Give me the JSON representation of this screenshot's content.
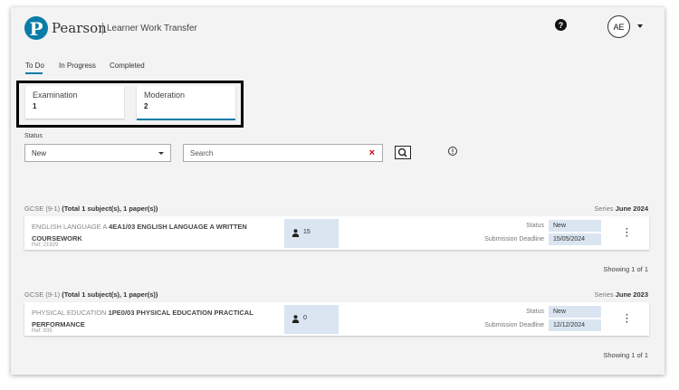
{
  "header": {
    "logo_letter": "P",
    "brand": "Pearson",
    "app_title": "Learner Work Transfer",
    "help_symbol": "?",
    "avatar_initials": "AE"
  },
  "tabs": [
    {
      "label": "To Do",
      "active": true
    },
    {
      "label": "In Progress",
      "active": false
    },
    {
      "label": "Completed",
      "active": false
    }
  ],
  "type_cards": [
    {
      "label": "Examination",
      "count": "1",
      "active": false
    },
    {
      "label": "Moderation",
      "count": "2",
      "active": true
    }
  ],
  "filters": {
    "status_label": "Status",
    "status_value": "New",
    "search_placeholder": "Search",
    "clear_symbol": "×"
  },
  "groups": [
    {
      "qualification": "GCSE (9-1)",
      "summary": "(Total 1 subject(s), 1 paper(s))",
      "series_label": "Series",
      "series_value": "June 2024",
      "row": {
        "subject": "ENGLISH LANGUAGE A",
        "paper": "4EA1/03 ENGLISH LANGUAGE A WRITTEN COURSEWORK",
        "ref": "Ref: 21929",
        "learners": "15",
        "status_label": "Status",
        "status_value": "New",
        "deadline_label": "Submission Deadline",
        "deadline_value": "15/05/2024"
      },
      "showing": "Showing 1 of 1"
    },
    {
      "qualification": "GCSE (9-1)",
      "summary": "(Total 1 subject(s), 1 paper(s))",
      "series_label": "Series",
      "series_value": "June 2023",
      "row": {
        "subject": "PHYSICAL EDUCATION",
        "paper": "1PE0/03 PHYSICAL EDUCATION PRACTICAL PERFORMANCE",
        "ref": "Ref: 935",
        "learners": "0",
        "status_label": "Status",
        "status_value": "New",
        "deadline_label": "Submission Deadline",
        "deadline_value": "12/12/2024"
      },
      "showing": "Showing 1 of 1"
    }
  ],
  "colors": {
    "brand_blue": "#0a7ca8",
    "field_fill": "#dae5f1",
    "clear_red": "#d0021b"
  }
}
